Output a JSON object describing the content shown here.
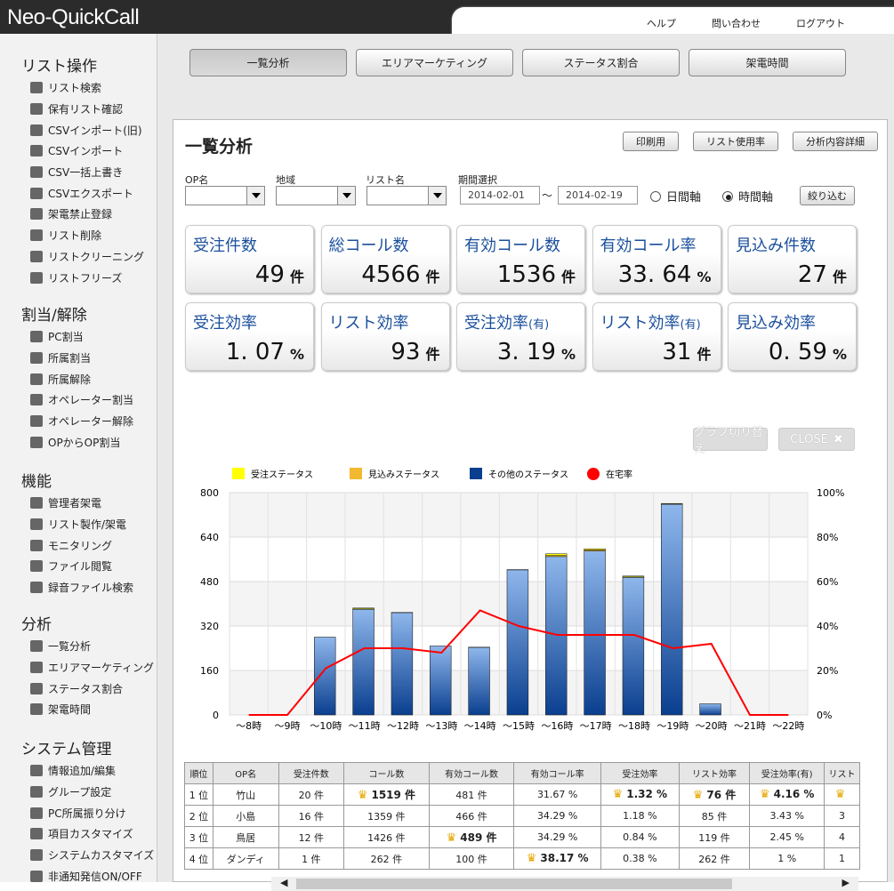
{
  "app": {
    "logo": "Neo-QuickCall",
    "links": [
      "ヘルプ",
      "問い合わせ",
      "ログアウト"
    ]
  },
  "sidebar": [
    {
      "title": "リスト操作",
      "items": [
        "リスト検索",
        "保有リスト確認",
        "CSVインポート(旧)",
        "CSVインポート",
        "CSV一括上書き",
        "CSVエクスポート",
        "架電禁止登録",
        "リスト削除",
        "リストクリーニング",
        "リストフリーズ"
      ]
    },
    {
      "title": "割当/解除",
      "items": [
        "PC割当",
        "所属割当",
        "所属解除",
        "オペレーター割当",
        "オペレーター解除",
        "OPからOP割当"
      ]
    },
    {
      "title": "機能",
      "items": [
        "管理者架電",
        "リスト製作/架電",
        "モニタリング",
        "ファイル閲覧",
        "録音ファイル検索"
      ]
    },
    {
      "title": "分析",
      "items": [
        "一覧分析",
        "エリアマーケティング",
        "ステータス割合",
        "架電時間"
      ]
    },
    {
      "title": "システム管理",
      "items": [
        "情報追加/編集",
        "グループ設定",
        "PC所属振り分け",
        "項目カスタマイズ",
        "システムカスタマイズ",
        "非通知発信ON/OFF"
      ]
    }
  ],
  "tabs": [
    "一覧分析",
    "エリアマーケティング",
    "ステータス割合",
    "架電時間"
  ],
  "panel": {
    "title": "一覧分析",
    "buttons": [
      "印刷用",
      "リスト使用率",
      "分析内容詳細"
    ]
  },
  "filters": {
    "op_label": "OP名",
    "area_label": "地域",
    "list_label": "リスト名",
    "period_label": "期間選択",
    "date_from": "2014-02-01",
    "tilde": "～",
    "date_to": "2014-02-19",
    "radio_day": "日間軸",
    "radio_time": "時間軸",
    "submit": "絞り込む"
  },
  "cards": [
    {
      "label": "受注件数",
      "value": "49",
      "unit": "件"
    },
    {
      "label": "総コール数",
      "value": "4566",
      "unit": "件"
    },
    {
      "label": "有効コール数",
      "value": "1536",
      "unit": "件"
    },
    {
      "label": "有効コール率",
      "value": "33. 64",
      "unit": "%"
    },
    {
      "label": "見込み件数",
      "value": "27",
      "unit": "件"
    },
    {
      "label": "受注効率",
      "value": "1. 07",
      "unit": "%"
    },
    {
      "label": "リスト効率",
      "value": "93",
      "unit": "件"
    },
    {
      "label": "受注効率",
      "label_sub": "(有)",
      "value": "3. 19",
      "unit": "%"
    },
    {
      "label": "リスト効率",
      "label_sub": "(有)",
      "value": "31",
      "unit": "件"
    },
    {
      "label": "見込み効率",
      "value": "0. 59",
      "unit": "%"
    }
  ],
  "graph_buttons": {
    "switch": "グラフ切り替え",
    "close": "CLOSE"
  },
  "chart_data": {
    "type": "bar",
    "categories": [
      "～8時",
      "～9時",
      "～10時",
      "～11時",
      "～12時",
      "～13時",
      "～14時",
      "～15時",
      "～16時",
      "～17時",
      "～18時",
      "～19時",
      "～20時",
      "～21時",
      "～22時"
    ],
    "series": [
      {
        "name": "受注ステータス",
        "color": "#ffff00",
        "values": [
          0,
          0,
          0,
          3,
          0,
          0,
          0,
          0,
          6,
          4,
          3,
          2,
          0,
          0,
          0
        ]
      },
      {
        "name": "見込みステータス",
        "color": "#f2b830",
        "values": [
          0,
          0,
          0,
          2,
          1,
          0,
          1,
          1,
          4,
          4,
          2,
          1,
          0,
          0,
          0
        ]
      },
      {
        "name": "その他のステータス",
        "color": "#0a3f8f",
        "values": [
          0,
          0,
          280,
          380,
          368,
          248,
          243,
          522,
          570,
          590,
          495,
          758,
          40,
          0,
          0
        ]
      },
      {
        "name": "在宅率",
        "color": "#ff0000",
        "axis": "right",
        "values": [
          0,
          0,
          21,
          30,
          30,
          28,
          47,
          40,
          36,
          36,
          36,
          30,
          32,
          0,
          0
        ]
      }
    ],
    "ylim": [
      0,
      800
    ],
    "yticks": [
      "0",
      "160",
      "320",
      "480",
      "640",
      "800"
    ],
    "y2lim": [
      0,
      100
    ],
    "y2ticks": [
      "0%",
      "20%",
      "40%",
      "60%",
      "80%",
      "100%"
    ],
    "legend": "top-left"
  },
  "table": {
    "headers": [
      "順位",
      "OP名",
      "受注件数",
      "コール数",
      "有効コール数",
      "有効コール率",
      "受注効率",
      "リスト効率",
      "受注効率(有)",
      "リスト"
    ],
    "rows": [
      [
        "1 位",
        "竹山",
        "20 件",
        "1519 件",
        "481 件",
        "31.67 %",
        "1.32 %",
        "76 件",
        "4.16 %",
        ""
      ],
      [
        "2 位",
        "小島",
        "16 件",
        "1359 件",
        "466 件",
        "34.29 %",
        "1.18 %",
        "85 件",
        "3.43 %",
        "3"
      ],
      [
        "3 位",
        "鳥居",
        "12 件",
        "1426 件",
        "489 件",
        "34.29 %",
        "0.84 %",
        "119 件",
        "2.45 %",
        "4"
      ],
      [
        "4 位",
        "ダンディ",
        "1 件",
        "262 件",
        "100 件",
        "38.17 %",
        "0.38 %",
        "262 件",
        "1 %",
        "1"
      ]
    ]
  }
}
